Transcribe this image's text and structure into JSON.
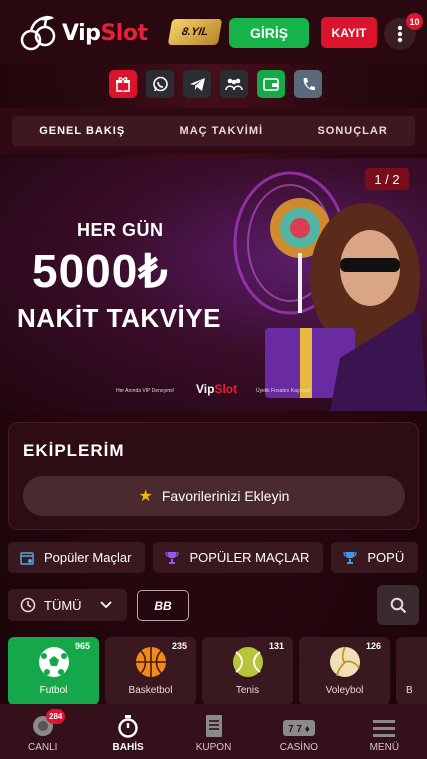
{
  "header": {
    "logo_prefix": "Vip",
    "logo_suffix": "Slot",
    "year_badge": "8.YIL",
    "login_label": "GİRİŞ",
    "register_label": "KAYIT",
    "notification_count": "10"
  },
  "social": [
    {
      "name": "gift-icon",
      "color": "#d9142c"
    },
    {
      "name": "whatsapp-icon",
      "color": "#2a2e33"
    },
    {
      "name": "telegram-icon",
      "color": "#2a2e33"
    },
    {
      "name": "community-icon",
      "color": "#2a2e33"
    },
    {
      "name": "wallet-icon",
      "color": "#17a84a"
    },
    {
      "name": "phone-icon",
      "color": "#2a2e33"
    }
  ],
  "tabs": [
    {
      "label": "GENEL BAKIŞ"
    },
    {
      "label": "MAÇ TAKVİMİ"
    },
    {
      "label": "SONUÇLAR"
    }
  ],
  "banner": {
    "counter": "1 / 2",
    "line1": "HER GÜN",
    "amount": "5000₺",
    "line3": "NAKİT TAKVİYE",
    "footer_left": "Her Anında VIP Deneyimi!",
    "brand_prefix": "Vip",
    "brand_suffix": "Slot",
    "footer_right": "Üyelik Fırsatını Kaçırma!"
  },
  "teams": {
    "title": "EKİPLERİM",
    "fav_label": "Favorilerinizi Ekleyin"
  },
  "chips": [
    {
      "label": "Popüler Maçlar"
    },
    {
      "label": "POPÜLER MAÇLAR"
    },
    {
      "label": "POPÜ"
    }
  ],
  "filter": {
    "select_label": "TÜMÜ",
    "bb_label": "BB"
  },
  "sports": [
    {
      "name": "Futbol",
      "count": "965"
    },
    {
      "name": "Basketbol",
      "count": "235"
    },
    {
      "name": "Tenis",
      "count": "131"
    },
    {
      "name": "Voleybol",
      "count": "126"
    },
    {
      "name": "B",
      "count": ""
    }
  ],
  "bottom_nav": [
    {
      "label": "CANLI",
      "badge": "284"
    },
    {
      "label": "BAHİS"
    },
    {
      "label": "KUPON"
    },
    {
      "label": "CASİNO"
    },
    {
      "label": "MENÜ"
    }
  ]
}
